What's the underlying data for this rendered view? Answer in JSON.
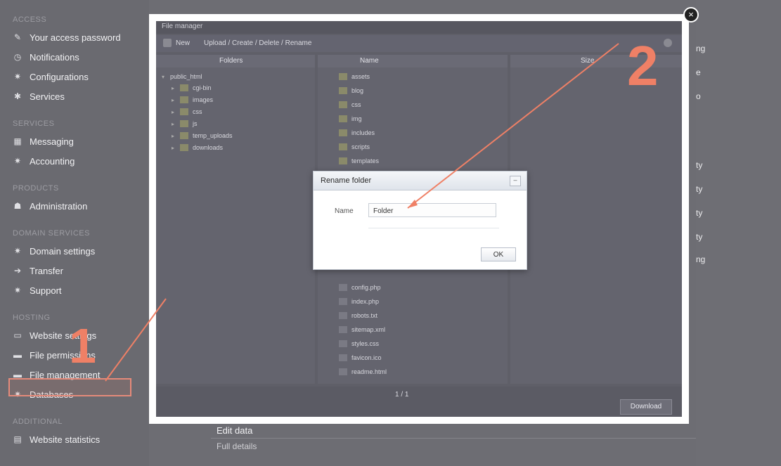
{
  "sidebar": {
    "groups": [
      {
        "heading": "ACCESS",
        "items": [
          {
            "label": "Your access password",
            "icon": "pencil-icon"
          },
          {
            "label": "Notifications",
            "icon": "clock-icon"
          },
          {
            "label": "Configurations",
            "icon": "gear-icon"
          },
          {
            "label": "Services",
            "icon": "wrench-icon"
          }
        ]
      },
      {
        "heading": "SERVICES",
        "items": [
          {
            "label": "Messaging",
            "icon": "grid-icon"
          },
          {
            "label": "Accounting",
            "icon": "gear-icon"
          }
        ]
      },
      {
        "heading": "PRODUCTS",
        "items": [
          {
            "label": "Administration",
            "icon": "user-icon"
          }
        ]
      },
      {
        "heading": "DOMAIN SERVICES",
        "items": [
          {
            "label": "Domain settings",
            "icon": "gear-icon"
          },
          {
            "label": "Transfer",
            "icon": "arrow-icon"
          },
          {
            "label": "Support",
            "icon": "gear-icon"
          }
        ]
      },
      {
        "heading": "HOSTING",
        "items": [
          {
            "label": "Website settings",
            "icon": "monitor-icon"
          },
          {
            "label": "File permissions",
            "icon": "folder-icon"
          },
          {
            "label": "File management",
            "icon": "folder-icon"
          },
          {
            "label": "Databases",
            "icon": "gear-icon"
          }
        ]
      },
      {
        "heading": "ADDITIONAL",
        "items": [
          {
            "label": "Website statistics",
            "icon": "chart-icon"
          }
        ]
      }
    ]
  },
  "right_strip": [
    "ng",
    "e",
    "o",
    "ty",
    "ty",
    "ty",
    "ty",
    "ng"
  ],
  "bottom": {
    "line1": "Edit data",
    "line2": "Full details"
  },
  "file_manager": {
    "window_title": "File manager",
    "toolbar": {
      "new_label": "New",
      "path_label": "Upload / Create / Delete / Rename"
    },
    "left_pane": {
      "header": "Folders",
      "root": "public_html",
      "folders": [
        "cgi-bin",
        "images",
        "css",
        "js",
        "temp_uploads",
        "downloads"
      ]
    },
    "middle_pane": {
      "header": "Name",
      "rows_top": [
        "assets",
        "blog",
        "css",
        "img",
        "includes",
        "scripts",
        "templates"
      ],
      "rows_bottom": [
        "config.php",
        "index.php",
        "robots.txt",
        "sitemap.xml",
        "styles.css",
        "favicon.ico",
        "readme.html"
      ],
      "pager": "1 / 1"
    },
    "right_pane": {
      "header": "Size"
    },
    "save_label": "Download"
  },
  "dialog": {
    "title": "Rename folder",
    "field_label": "Name",
    "field_value": "Folder",
    "ok_label": "OK",
    "min_glyph": "–"
  },
  "annotations": {
    "step1": "1",
    "step2": "2",
    "accent": "#ef8066"
  },
  "frame": {
    "close_glyph": "×"
  }
}
